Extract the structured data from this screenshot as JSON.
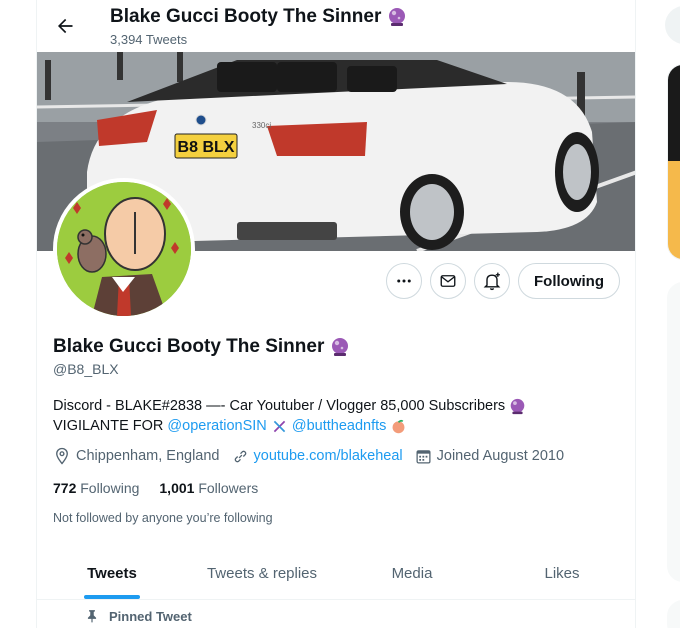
{
  "header": {
    "title": "Blake Gucci Booty The Sinner",
    "tweet_count": "3,394 Tweets"
  },
  "banner": {
    "plate": "B8 BLX",
    "badge": "330ci"
  },
  "actions": {
    "following_label": "Following"
  },
  "profile": {
    "name": "Blake Gucci Booty The Sinner",
    "handle": "@B8_BLX",
    "bio_line1": "Discord - BLAKE#2838 —- Car Youtuber / Vlogger 85,000 Subscribers",
    "bio_line2_prefix": "VIGILANTE FOR",
    "bio_link1": "@operationSIN",
    "bio_link2": "@buttheadnfts",
    "location": "Chippenham, England",
    "website": "youtube.com/blakeheal",
    "joined": "Joined August 2010",
    "following_count": "772",
    "following_label": "Following",
    "followers_count": "1,001",
    "followers_label": "Followers",
    "not_followed": "Not followed by anyone you’re following"
  },
  "tabs": [
    {
      "label": "Tweets"
    },
    {
      "label": "Tweets & replies"
    },
    {
      "label": "Media"
    },
    {
      "label": "Likes"
    }
  ],
  "pinned_label": "Pinned Tweet",
  "colors": {
    "accent": "#1d9bf0",
    "text": "#0f1419",
    "muted": "#536471",
    "border": "#cfd9de"
  }
}
